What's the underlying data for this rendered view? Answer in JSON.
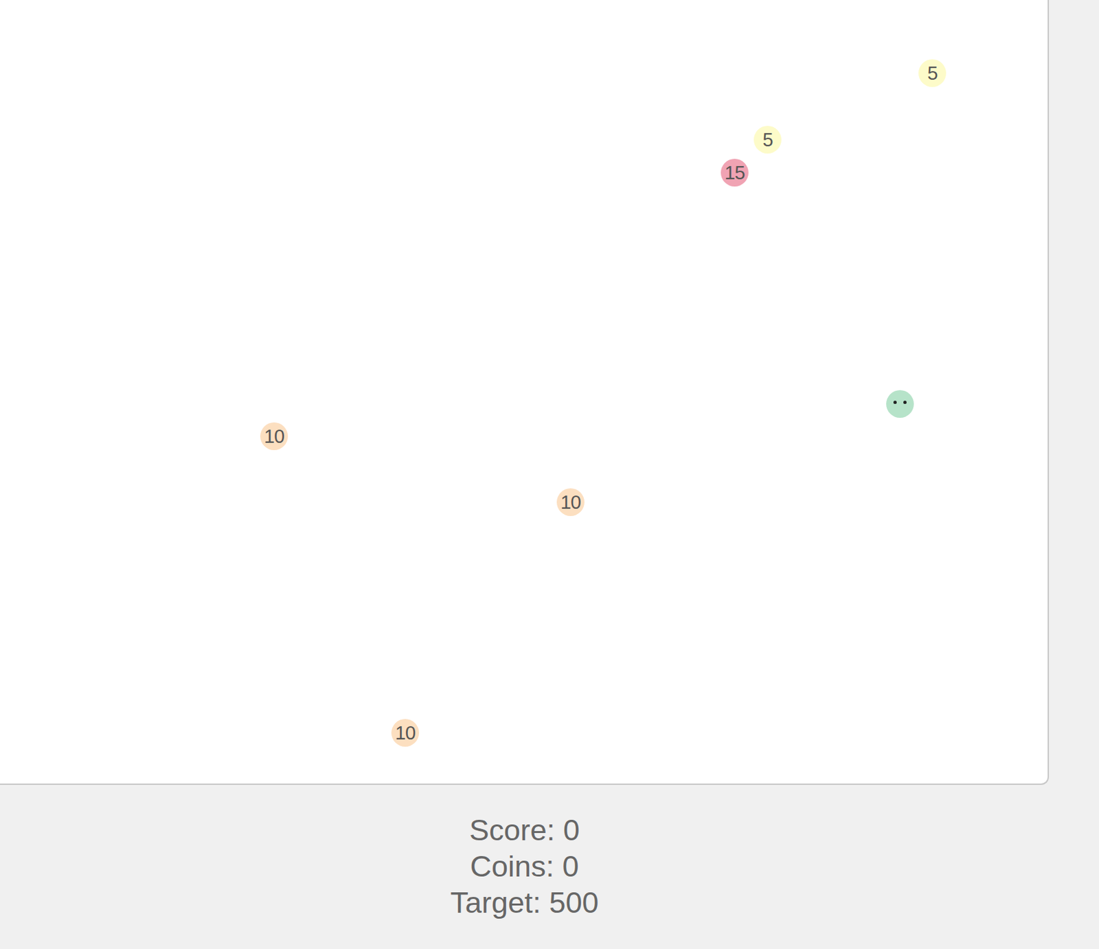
{
  "game": {
    "pieces": [
      {
        "kind": "coin",
        "label": "5",
        "color": "#fdfbc9"
      },
      {
        "kind": "coin",
        "label": "5",
        "color": "#fdfbc9"
      },
      {
        "kind": "coin",
        "label": "15",
        "color": "#f0a3b3"
      },
      {
        "kind": "player",
        "color": "#b6e3c9"
      },
      {
        "kind": "coin",
        "label": "10",
        "color": "#fcdfc0"
      },
      {
        "kind": "coin",
        "label": "10",
        "color": "#fcdfc0"
      },
      {
        "kind": "coin",
        "label": "10",
        "color": "#fcdfc0"
      }
    ]
  },
  "stats": [
    "Score: 0",
    "Coins: 0",
    "Target: 500"
  ]
}
